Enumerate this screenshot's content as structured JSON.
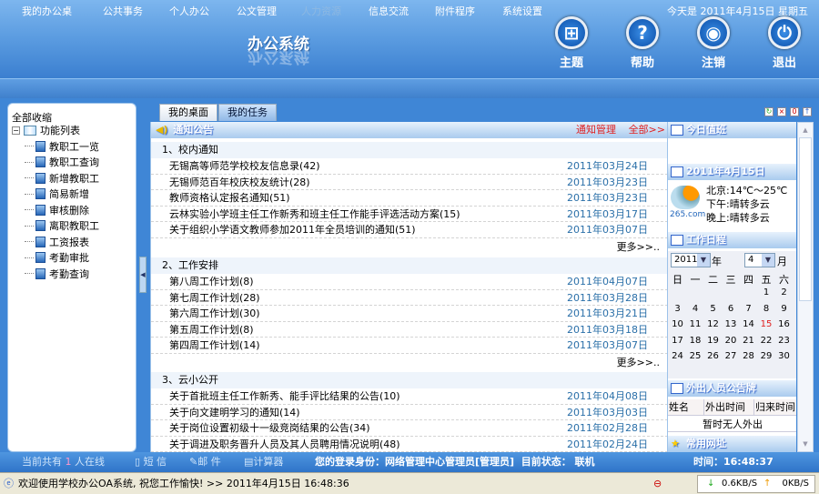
{
  "header": {
    "title": "办公系统",
    "buttons": [
      {
        "label": "主题",
        "icon": "theme-icon"
      },
      {
        "label": "帮助",
        "icon": "help-icon"
      },
      {
        "label": "注销",
        "icon": "logout-icon"
      },
      {
        "label": "退出",
        "icon": "exit-icon"
      }
    ]
  },
  "nav": {
    "items": [
      "我的办公桌",
      "公共事务",
      "个人办公",
      "公文管理",
      "人力资源",
      "信息交流",
      "附件程序",
      "系统设置"
    ],
    "today": "今天是 2011年4月15日 星期五"
  },
  "sidebar": {
    "collapse_all": "全部收缩",
    "root": "功能列表",
    "items": [
      "教职工一览",
      "教职工查询",
      "新增教职工",
      "简易新增",
      "审核删除",
      "离职教职工",
      "工资报表",
      "考勤审批",
      "考勤查询"
    ]
  },
  "tabs": [
    "我的桌面",
    "我的任务"
  ],
  "notice": {
    "title": "通知公告",
    "manage": "通知管理",
    "all": "全部>>",
    "more": "更多>>..",
    "sections": [
      {
        "title": "1、校内通知",
        "items": [
          [
            "无锡高等师范学校校友信息录(42)",
            "2011年03月24日"
          ],
          [
            "无锡师范百年校庆校友统计(28)",
            "2011年03月23日"
          ],
          [
            "教师资格认定报名通知(51)",
            "2011年03月23日"
          ],
          [
            "云林实验小学班主任工作新秀和班主任工作能手评选活动方案(15)",
            "2011年03月17日"
          ],
          [
            "关于组织小学语文教师参加2011年全员培训的通知(51)",
            "2011年03月07日"
          ]
        ]
      },
      {
        "title": "2、工作安排",
        "items": [
          [
            "第八周工作计划(8)",
            "2011年04月07日"
          ],
          [
            "第七周工作计划(28)",
            "2011年03月28日"
          ],
          [
            "第六周工作计划(30)",
            "2011年03月21日"
          ],
          [
            "第五周工作计划(8)",
            "2011年03月18日"
          ],
          [
            "第四周工作计划(14)",
            "2011年03月07日"
          ]
        ]
      },
      {
        "title": "3、云小公开",
        "items": [
          [
            "关于首批班主任工作新秀、能手评比结果的公告(10)",
            "2011年04月08日"
          ],
          [
            "关于向文建明学习的通知(14)",
            "2011年03月03日"
          ],
          [
            "关于岗位设置初级十一级竞岗结果的公告(34)",
            "2011年02月28日"
          ],
          [
            "关于调进及职务晋升人员及其人员聘用情况说明(48)",
            "2011年02月24日"
          ]
        ]
      }
    ]
  },
  "right": {
    "duty_title": "今日值班",
    "date_title": "2011年4月15日",
    "weather": {
      "brand": "265.com",
      "lines": [
        "北京:14℃～25℃",
        "下午:晴转多云",
        "晚上:晴转多云"
      ]
    },
    "schedule_title": "工作日程",
    "year": "2011",
    "year_suffix": "年",
    "month": "4",
    "month_suffix": "月",
    "weekdays": [
      "日",
      "一",
      "二",
      "三",
      "四",
      "五",
      "六"
    ],
    "first_weekday": 5,
    "days": 30,
    "today": 15,
    "today_color": "#e02020",
    "out_title": "外出人员公告牌",
    "out_cols": [
      "姓名",
      "外出时间",
      "归来时间"
    ],
    "out_empty": "暂时无人外出",
    "links_title": "常用网址"
  },
  "infobar": {
    "online_prefix": "当前共有",
    "online_count": "1",
    "online_suffix": "人在线",
    "sms": "短 信",
    "mail": "邮 件",
    "calc": "计算器",
    "identity": "您的登录身份：网络管理中心管理员[管理员]  目前状态： 联机",
    "time": "时间：16:48:37"
  },
  "statusbar": {
    "message": "欢迎使用学校办公OA系统, 祝您工作愉快! >> 2011年4月15日 16:48:36",
    "down": "0.6KB/S",
    "up": "0KB/S"
  }
}
